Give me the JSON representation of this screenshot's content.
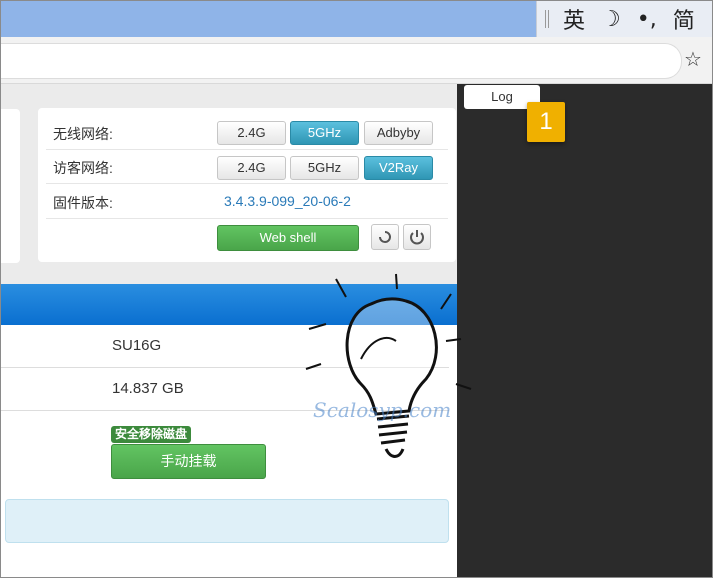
{
  "ime": {
    "items": [
      "英",
      "☽",
      "•,",
      "简"
    ]
  },
  "toolbar": {
    "bookmark_icon": "star-icon"
  },
  "status_card": {
    "wireless": {
      "label": "无线网络:",
      "buttons": [
        "2.4G",
        "5GHz",
        "Adbyby"
      ],
      "active": "5GHz"
    },
    "guest": {
      "label": "访客网络:",
      "buttons": [
        "2.4G",
        "5GHz",
        "V2Ray"
      ],
      "active": "V2Ray"
    },
    "firmware": {
      "label": "固件版本:",
      "version": "3.4.3.9-099_20-06-2"
    },
    "web_shell_label": "Web shell",
    "icons": [
      "refresh-icon",
      "power-icon"
    ]
  },
  "log_tab": {
    "label": "Log"
  },
  "badge": {
    "number": "1"
  },
  "disk": {
    "name": "SU16G",
    "size": "14.837 GB",
    "safe_remove_label": "安全移除磁盘",
    "mount_button": "手动挂载"
  },
  "watermark": {
    "text": "Scalosyp.com"
  },
  "colors": {
    "accent": "#2f96b4",
    "green": "#4aa54a",
    "blue_bar": "#0a6fd0",
    "badge": "#f0b000"
  }
}
